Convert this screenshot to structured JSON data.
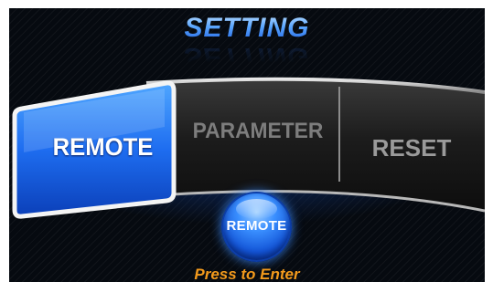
{
  "header": {
    "title": "SETTING"
  },
  "menu": {
    "items": [
      {
        "label": "REMOTE",
        "selected": true
      },
      {
        "label": "PARAMETER",
        "selected": false
      },
      {
        "label": "RESET",
        "selected": false
      }
    ]
  },
  "action": {
    "button_label": "REMOTE",
    "hint": "Press to Enter"
  },
  "colors": {
    "accent": "#1f6fff",
    "hint": "#f39a1c",
    "background": "#060a10"
  },
  "icons": []
}
